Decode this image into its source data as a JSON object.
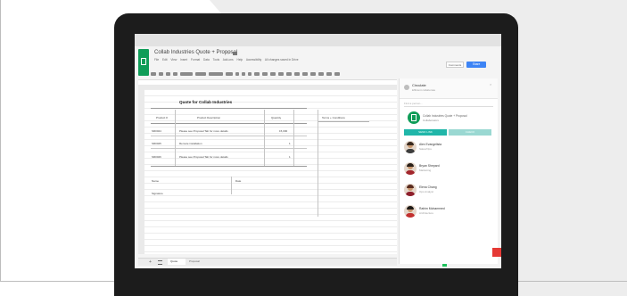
{
  "app": {
    "title": "Collab Industries Quote + Proposal",
    "menu": [
      "File",
      "Edit",
      "View",
      "Insert",
      "Format",
      "Data",
      "Tools",
      "Add-ons",
      "Help",
      "Accessibility",
      "All changes saved in Drive"
    ],
    "comments_label": "Comments",
    "share_label": "Share"
  },
  "sheet": {
    "title": "Quote for Collab Industries",
    "headers": {
      "product": "Product #",
      "description": "Product Description",
      "quantity": "Quantity",
      "terms": "Terms + Conditions"
    },
    "rows": [
      {
        "product": "SR0024",
        "description": "Please see Proposal Tab for more details",
        "quantity": "15,000"
      },
      {
        "product": "SR0025",
        "description": "Remote installation",
        "quantity": "1"
      },
      {
        "product": "SR0026",
        "description": "Please see Proposal Tab for more details",
        "quantity": "1"
      }
    ],
    "name_label": "Name",
    "date_label": "Date",
    "signature_label": "Signature"
  },
  "tabs": [
    "Quote",
    "Proposal"
  ],
  "sidebar": {
    "title": "Circulate",
    "subtitle": "Efficient collaborate",
    "search_placeholder": "Find a person...",
    "app_name": "Collab Industries Quote + Proposal",
    "app_sub": "Collaborators",
    "button_left": "SEND LINK",
    "button_right": "CHECK",
    "people": [
      {
        "name": "Alex Evangelista",
        "role": "Sales/Ops",
        "hair": "#3a2a1f",
        "shirt": "#3d3d3d"
      },
      {
        "name": "Bryan Shepard",
        "role": "Marketing",
        "hair": "#2a2018",
        "shirt": "#a3262c"
      },
      {
        "name": "Elena Chang",
        "role": "Ops Analyst",
        "hair": "#5a2b1e",
        "shirt": "#8e1f2b"
      },
      {
        "name": "Rahim Mohammed",
        "role": "Architecture",
        "hair": "#1e1a17",
        "shirt": "#c2302f"
      }
    ]
  }
}
